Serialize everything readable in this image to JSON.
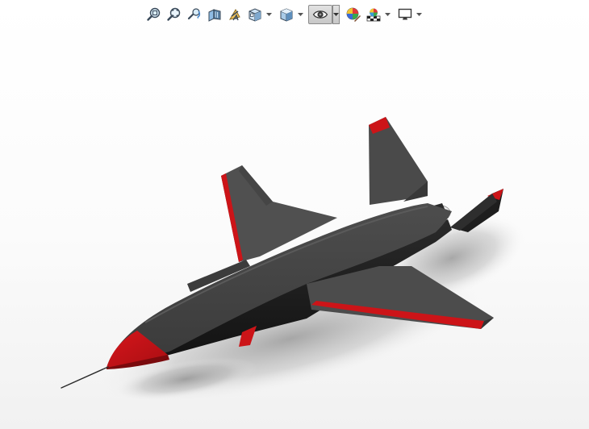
{
  "toolbar": {
    "items": [
      {
        "name": "zoom-to-fit-icon",
        "has_dropdown": false,
        "active": false
      },
      {
        "name": "zoom-to-area-icon",
        "has_dropdown": false,
        "active": false
      },
      {
        "name": "previous-view-icon",
        "has_dropdown": false,
        "active": false
      },
      {
        "name": "section-view-icon",
        "has_dropdown": false,
        "active": false
      },
      {
        "name": "dynamic-annotation-icon",
        "has_dropdown": false,
        "active": false
      },
      {
        "name": "view-orientation-icon",
        "has_dropdown": true,
        "active": false
      },
      {
        "name": "display-style-icon",
        "has_dropdown": true,
        "active": false
      },
      {
        "name": "hide-show-items-icon",
        "has_dropdown": true,
        "active": true
      },
      {
        "name": "edit-appearance-icon",
        "has_dropdown": false,
        "active": false
      },
      {
        "name": "apply-scene-icon",
        "has_dropdown": true,
        "active": false
      },
      {
        "name": "view-settings-icon",
        "has_dropdown": true,
        "active": false
      }
    ]
  },
  "model": {
    "body_color": "#4a4a4a",
    "accent_color": "#cc1418",
    "shadow_color": "#9a9a9a"
  }
}
